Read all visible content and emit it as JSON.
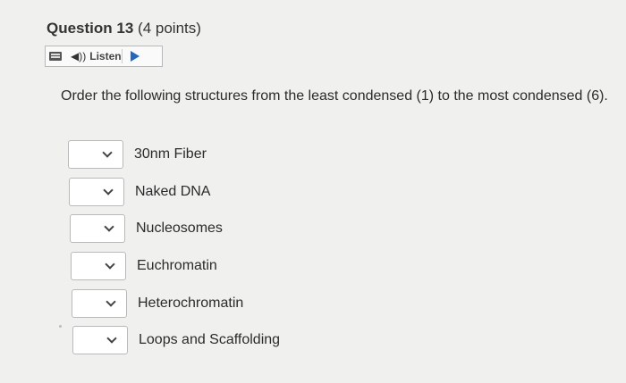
{
  "question": {
    "number_label": "Question 13",
    "points_label": "(4 points)"
  },
  "listen": {
    "label": "Listen",
    "speaker_glyph": "◀))"
  },
  "prompt": "Order the following structures from the least condensed (1) to the most condensed (6).",
  "items": [
    {
      "label": "30nm Fiber",
      "selected": ""
    },
    {
      "label": "Naked DNA",
      "selected": ""
    },
    {
      "label": "Nucleosomes",
      "selected": ""
    },
    {
      "label": "Euchromatin",
      "selected": ""
    },
    {
      "label": "Heterochromatin",
      "selected": ""
    },
    {
      "label": "Loops and Scaffolding",
      "selected": ""
    }
  ],
  "colors": {
    "background": "#f0f0ee",
    "play_accent": "#2a66b6"
  }
}
